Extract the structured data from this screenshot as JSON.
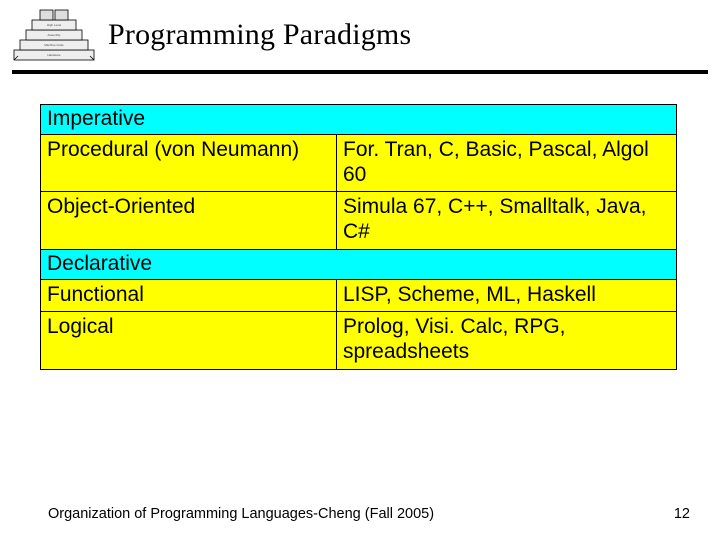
{
  "title": "Programming Paradigms",
  "sections": [
    {
      "header": "Imperative",
      "rows": [
        {
          "label": "Procedural (von Neumann)",
          "langs": "For. Tran, C, Basic, Pascal, Algol 60"
        },
        {
          "label": "Object-Oriented",
          "langs": "Simula 67, C++, Smalltalk, Java, C#"
        }
      ]
    },
    {
      "header": "Declarative",
      "rows": [
        {
          "label": "Functional",
          "langs": "LISP, Scheme, ML, Haskell"
        },
        {
          "label": "Logical",
          "langs": "Prolog, Visi. Calc, RPG, spreadsheets"
        }
      ]
    }
  ],
  "footer": "Organization of Programming Languages-Cheng (Fall 2005)",
  "page_number": "12"
}
